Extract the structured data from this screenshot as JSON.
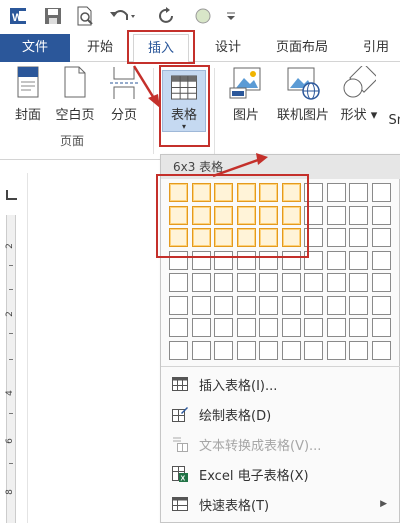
{
  "quick_access": {
    "app_icon": "word-icon",
    "items": [
      "save-icon",
      "print-preview-icon",
      "undo-icon",
      "redo-icon",
      "circle-icon",
      "customize-icon"
    ]
  },
  "tabs": [
    {
      "label": "文件"
    },
    {
      "label": "开始"
    },
    {
      "label": "插入"
    },
    {
      "label": "设计"
    },
    {
      "label": "页面布局"
    },
    {
      "label": "引用"
    }
  ],
  "ribbon": {
    "pages_group": {
      "cover": "封面",
      "blank": "空白页",
      "break": "分页",
      "label": "页面"
    },
    "table_button": "表格",
    "picture": "图片",
    "online_picture": "联机图片",
    "shapes": "形状",
    "smartart": "Sm"
  },
  "ruler": {
    "numbers": [
      "2",
      "2",
      "4",
      "6",
      "8"
    ]
  },
  "table_menu": {
    "header": "6x3 表格",
    "grid": {
      "columns": 10,
      "rows": 8,
      "highlight_cols": 6,
      "highlight_rows": 3
    },
    "items": [
      {
        "label": "插入表格(I)...",
        "icon": "table-icon",
        "enabled": true
      },
      {
        "label": "绘制表格(D)",
        "icon": "draw-table-icon",
        "enabled": true
      },
      {
        "label": "文本转换成表格(V)...",
        "icon": "convert-text-icon",
        "enabled": false
      },
      {
        "label": "Excel 电子表格(X)",
        "icon": "excel-icon",
        "enabled": true
      },
      {
        "label": "快速表格(T)",
        "icon": "quick-table-icon",
        "enabled": true
      }
    ]
  },
  "colors": {
    "accent": "#2b579a",
    "annotation": "#c4302b",
    "highlight": "#e39a20"
  }
}
